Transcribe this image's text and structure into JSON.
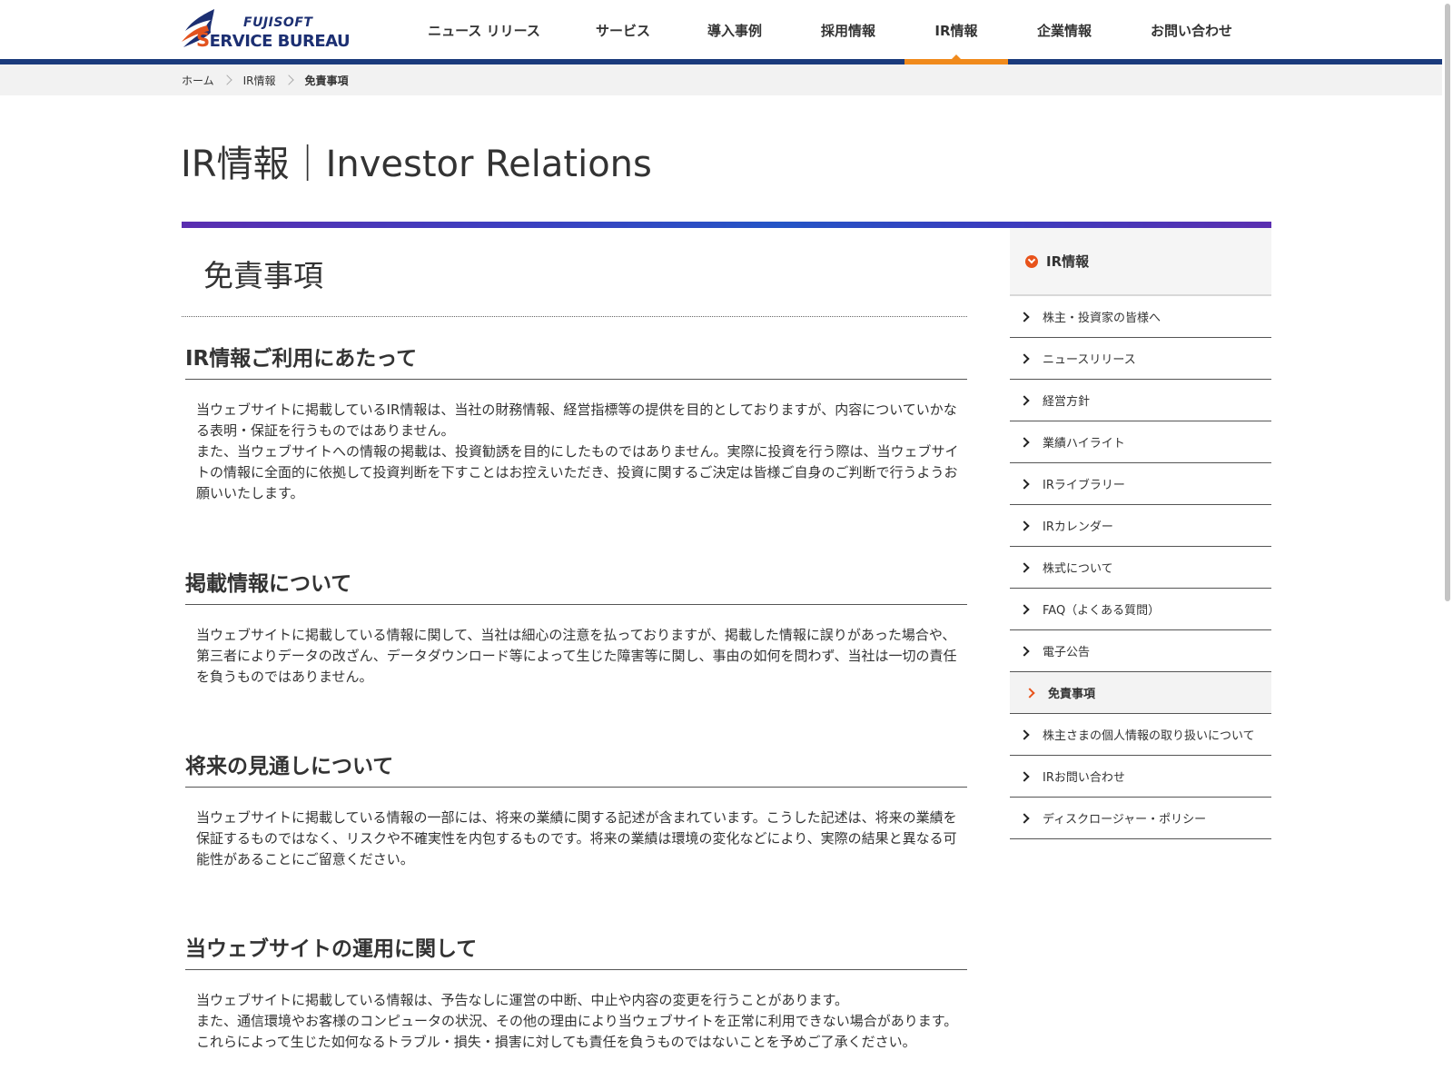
{
  "header": {
    "logo": {
      "line1": "FUJISOFT",
      "line2_initial": "S",
      "line2_rest": "ERVICE BUREAU",
      "colors": {
        "navy": "#1c2f72",
        "orange": "#e2531f"
      }
    },
    "nav": [
      {
        "label": "ニュース リリース"
      },
      {
        "label": "サービス"
      },
      {
        "label": "導入事例"
      },
      {
        "label": "採用情報"
      },
      {
        "label": "IR情報",
        "active": true
      },
      {
        "label": "企業情報"
      },
      {
        "label": "お問い合わせ"
      }
    ],
    "accent_color": "#f08a1c",
    "bar_color": "#1b3b7c"
  },
  "breadcrumb": [
    "ホーム",
    "IR情報",
    "免責事項"
  ],
  "page": {
    "title": "IR情報｜Investor Relations",
    "subtitle": "免責事項"
  },
  "sections": [
    {
      "heading": "IR情報ご利用にあたって",
      "paragraphs": [
        "当ウェブサイトに掲載しているIR情報は、当社の財務情報、経営指標等の提供を目的としておりますが、内容についていかなる表明・保証を行うものではありません。",
        "また、当ウェブサイトへの情報の掲載は、投資勧誘を目的にしたものではありません。実際に投資を行う際は、当ウェブサイトの情報に全面的に依拠して投資判断を下すことはお控えいただき、投資に関するご決定は皆様ご自身のご判断で行うようお願いいたします。"
      ]
    },
    {
      "heading": "掲載情報について",
      "paragraphs": [
        "当ウェブサイトに掲載している情報に関して、当社は細心の注意を払っておりますが、掲載した情報に誤りがあった場合や、第三者によりデータの改ざん、データダウンロード等によって生じた障害等に関し、事由の如何を問わず、当社は一切の責任を負うものではありません。"
      ]
    },
    {
      "heading": "将来の見通しについて",
      "paragraphs": [
        "当ウェブサイトに掲載している情報の一部には、将来の業績に関する記述が含まれています。こうした記述は、将来の業績を保証するものではなく、リスクや不確実性を内包するものです。将来の業績は環境の変化などにより、実際の結果と異なる可能性があることにご留意ください。"
      ]
    },
    {
      "heading": "当ウェブサイトの運用に関して",
      "paragraphs": [
        "当ウェブサイトに掲載している情報は、予告なしに運営の中断、中止や内容の変更を行うことがあります。",
        "また、通信環境やお客様のコンピュータの状況、その他の理由により当ウェブサイトを正常に利用できない場合があります。これらによって生じた如何なるトラブル・損失・損害に対しても責任を負うものではないことを予めご了承ください。"
      ]
    }
  ],
  "sidebar": {
    "heading": "IR情報",
    "icon": "chevron-down-circle-icon",
    "items": [
      {
        "label": "株主・投資家の皆様へ"
      },
      {
        "label": "ニュースリリース"
      },
      {
        "label": "経営方針"
      },
      {
        "label": "業績ハイライト"
      },
      {
        "label": "IRライブラリー"
      },
      {
        "label": "IRカレンダー"
      },
      {
        "label": "株式について"
      },
      {
        "label": "FAQ（よくある質問）"
      },
      {
        "label": "電子公告"
      },
      {
        "label": "免責事項",
        "active": true
      },
      {
        "label": "株主さまの個人情報の取り扱いについて"
      },
      {
        "label": "IRお問い合わせ"
      },
      {
        "label": "ディスクロージャー・ポリシー"
      }
    ]
  }
}
